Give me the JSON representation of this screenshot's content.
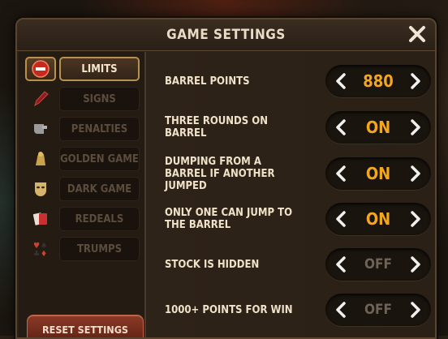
{
  "window": {
    "title": "GAME SETTINGS",
    "close_icon": "close-icon"
  },
  "sidebar": {
    "items": [
      {
        "label": "LIMITS",
        "icon": "limits-icon",
        "active": true
      },
      {
        "label": "SIGNS",
        "icon": "pen-icon",
        "active": false
      },
      {
        "label": "PENALTIES",
        "icon": "whistle-icon",
        "active": false
      },
      {
        "label": "GOLDEN GAME",
        "icon": "golden-game-icon",
        "active": false
      },
      {
        "label": "DARK GAME",
        "icon": "mask-icon",
        "active": false
      },
      {
        "label": "REDEALS",
        "icon": "cards-icon",
        "active": false
      },
      {
        "label": "TRUMPS",
        "icon": "suits-icon",
        "active": false
      }
    ],
    "reset_label": "RESET SETTINGS"
  },
  "settings": [
    {
      "label": "BARREL POINTS",
      "value": "880",
      "enabled": true
    },
    {
      "label": "THREE ROUNDS ON BARREL",
      "value": "ON",
      "enabled": true
    },
    {
      "label": "DUMPING FROM A BARREL IF ANOTHER JUMPED",
      "value": "ON",
      "enabled": true
    },
    {
      "label": "ONLY ONE CAN JUMP TO THE BARREL",
      "value": "ON",
      "enabled": true
    },
    {
      "label": "STOCK IS HIDDEN",
      "value": "OFF",
      "enabled": false
    },
    {
      "label": "1000+ POINTS FOR WIN",
      "value": "OFF",
      "enabled": false
    }
  ],
  "colors": {
    "accent": "#f2a71e",
    "active_border": "#b89150",
    "reset": "#8b3a26"
  }
}
